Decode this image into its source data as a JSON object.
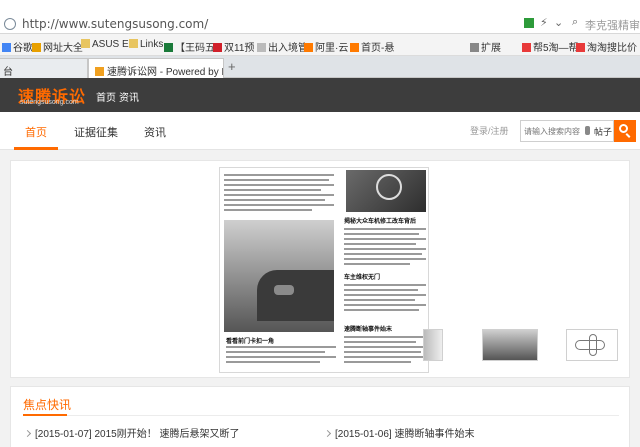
{
  "browser": {
    "url": "http://www.sutengsusong.com/",
    "search_hint": "李克强精审计",
    "bookmarks": [
      "谷歌",
      "网址大全",
      "ASUS E-",
      "Links",
      "【王码五",
      "双11预",
      "出入境管",
      "阿里·云",
      "首页-悬",
      "扩展",
      "帮5淘—帮5",
      "淘淘搜比价"
    ],
    "tabs": [
      {
        "label": "台",
        "active": false
      },
      {
        "label": "速腾诉讼网 - Powered by Dis",
        "active": true
      }
    ],
    "new_tab": "+"
  },
  "site": {
    "logo_main": "速腾诉讼",
    "logo_sub": "sutengsusong.com",
    "top_nav": [
      "首页",
      "资讯"
    ],
    "main_nav": [
      {
        "label": "首页",
        "active": true
      },
      {
        "label": "证据征集",
        "active": false
      },
      {
        "label": "资讯",
        "active": false
      }
    ],
    "login_text": "登录/注册",
    "search_placeholder": "请输入搜索内容",
    "search_scope": "帖子"
  },
  "carousel": {
    "headline_1": "看看前门卡扣一角",
    "headline_2": "揭秘大众车机修工改车背后",
    "headline_3": "速腾断轴事件始末",
    "headline_4": "车主维权无门"
  },
  "section": {
    "title": "焦点快讯",
    "items": [
      {
        "date": "[2015-01-07]",
        "text": "2015刚开始！ 速腾后悬架又断了"
      },
      {
        "date": "[2015-01-06]",
        "text": "速腾断轴事件始末"
      }
    ]
  },
  "colors": {
    "accent": "#ff6a00",
    "topbar": "#3d3d3d"
  }
}
